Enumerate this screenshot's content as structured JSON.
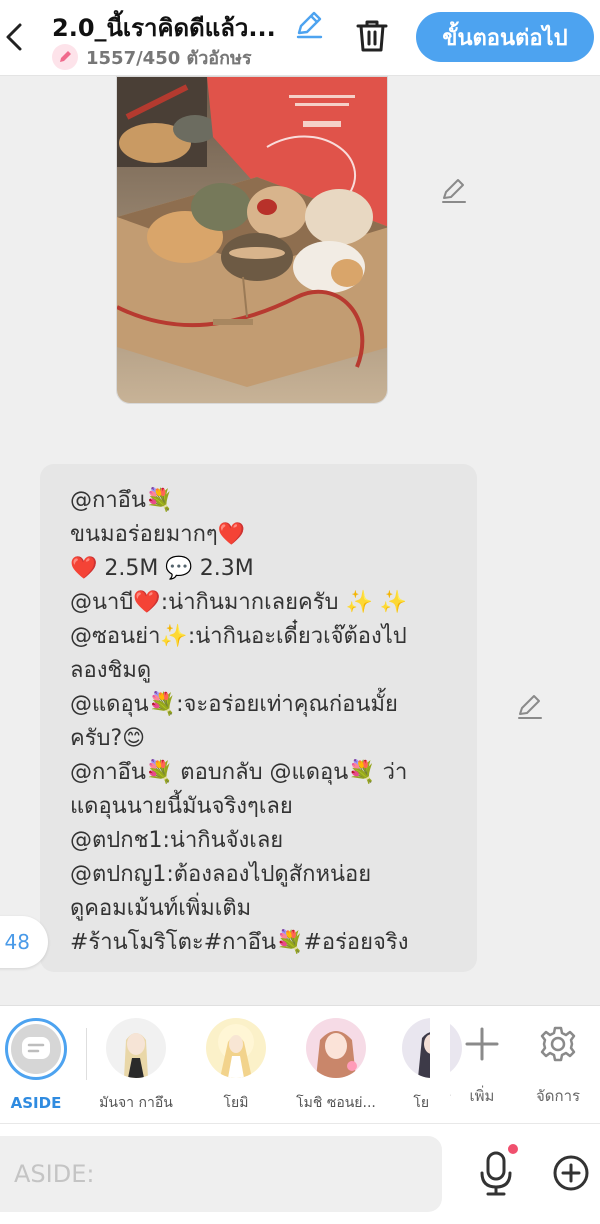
{
  "header": {
    "title": "2.0_นี้เราคิดดีแล้ว...",
    "char_count": "1557/450 ตัวอักษร",
    "next_button": "ขั้นตอนต่อไป"
  },
  "post": {
    "lines": [
      "@กาอึน💐",
      "ขนมอร่อยมากๆ❤️",
      "❤️ 2.5M 💬 2.3M",
      "@นาบี❤️:น่ากินมากเลยครับ ✨ ✨",
      "@ซอนย่า✨:น่ากินอะเดี๋ยวเจ๊ต้องไป",
      "ลองชิมดู",
      "@แดอุน💐:จะอร่อยเท่าคุณก่อนมั้ย",
      "ครับ?😊",
      "@กาอึน💐 ตอบกลับ @แดอุน💐 ว่า",
      "แดอุนนายนี้มันจริงๆเลย",
      "@ตปกช1:น่ากินจังเลย",
      "@ตปกญ1:ต้องลองไปดูสักหน่อย",
      "ดูคอมเม้นท์เพิ่มเติม",
      "#ร้านโมริโตะ#กาอึน💐#อร่อยจริง"
    ]
  },
  "side_tab": {
    "label": "48"
  },
  "characters": {
    "aside_label": "ASIDE",
    "items": [
      {
        "name": "มันจา กาอึน"
      },
      {
        "name": "โยมิ"
      },
      {
        "name": "โมชิ ซอนย่..."
      },
      {
        "name": "โยชิ โ"
      }
    ],
    "add_label": "เพิ่ม",
    "manage_label": "จัดการ"
  },
  "input": {
    "placeholder": "ASIDE:"
  },
  "colors": {
    "accent": "#4da3f0",
    "bubble": "#e6e6e6",
    "background": "#efefef",
    "notification_dot": "#f0506e"
  }
}
